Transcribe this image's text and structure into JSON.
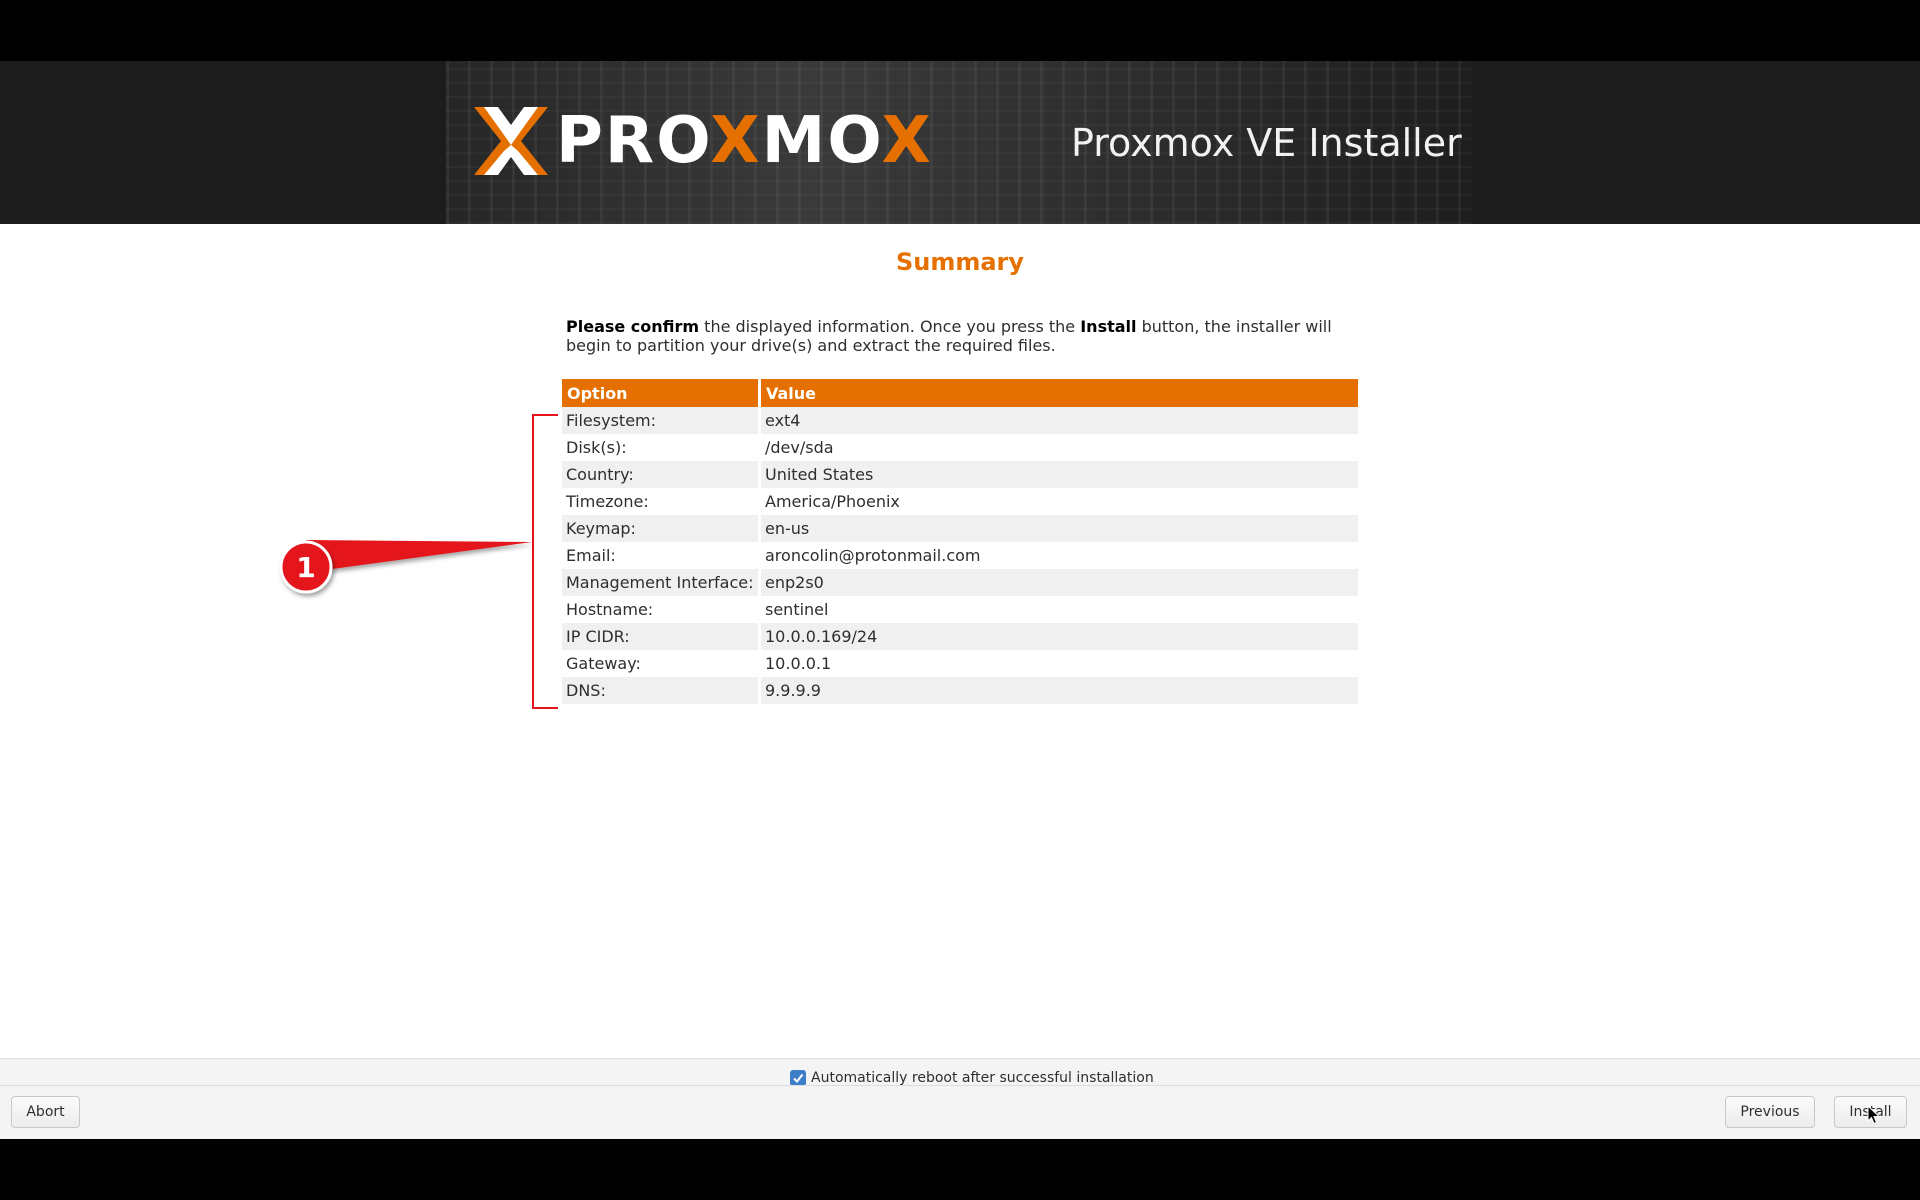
{
  "header": {
    "logo": {
      "prefix": "PRO",
      "x": "X",
      "middle": "MO",
      "x2": "X"
    },
    "title": "Proxmox VE Installer"
  },
  "summary": {
    "title": "Summary",
    "intro": {
      "bold1": "Please confirm",
      "text1": " the displayed information. Once you press the ",
      "bold2": "Install",
      "text2": " button, the installer will begin to partition your drive(s) and extract the required files."
    },
    "table": {
      "headers": [
        "Option",
        "Value"
      ],
      "rows": [
        [
          "Filesystem:",
          "ext4"
        ],
        [
          "Disk(s):",
          "/dev/sda"
        ],
        [
          "Country:",
          "United States"
        ],
        [
          "Timezone:",
          "America/Phoenix"
        ],
        [
          "Keymap:",
          "en-us"
        ],
        [
          "Email:",
          "aroncolin@protonmail.com"
        ],
        [
          "Management Interface:",
          "enp2s0"
        ],
        [
          "Hostname:",
          "sentinel"
        ],
        [
          "IP CIDR:",
          "10.0.0.169/24"
        ],
        [
          "Gateway:",
          "10.0.0.1"
        ],
        [
          "DNS:",
          "9.9.9.9"
        ]
      ]
    }
  },
  "annotation": {
    "number": "1"
  },
  "footer": {
    "autoreboot_label": "Automatically reboot after successful installation",
    "autoreboot_checked": true,
    "abort_label": "Abort",
    "previous_label": "Previous",
    "install_label": "Install"
  },
  "colors": {
    "accent": "#e57000",
    "annotation": "#e4141e",
    "checkbox": "#3d7ec9"
  }
}
